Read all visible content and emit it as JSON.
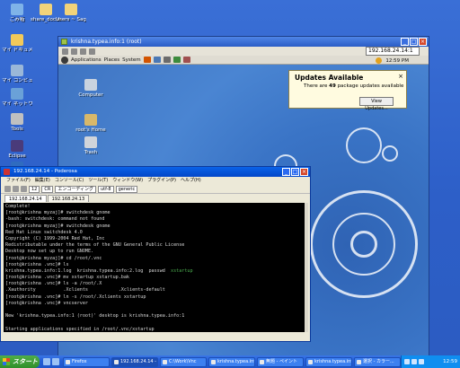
{
  "desktop_icons": [
    {
      "label": "ごみ箱",
      "icon": "recycle-bin-icon",
      "color": "#7fb3e8"
    },
    {
      "label": "share_docum",
      "icon": "folder-icon",
      "color": "#f2d37a"
    },
    {
      "label": "Users ~ Sagem",
      "icon": "folder-icon",
      "color": "#f2d37a"
    },
    {
      "label": "マイ ドキュメント",
      "icon": "my-documents-icon",
      "color": "#f2c95a"
    },
    {
      "label": "マイ コンピュータ",
      "icon": "my-computer-icon",
      "color": "#9ab7d8"
    },
    {
      "label": "マイ ネットワーク",
      "icon": "network-places-icon",
      "color": "#6aa1d8"
    },
    {
      "label": "Tools",
      "icon": "tools-icon",
      "color": "#c0c0c0"
    },
    {
      "label": "Eclipse",
      "icon": "eclipse-icon",
      "color": "#4a3b7a"
    },
    {
      "label": "VirtualBox",
      "icon": "virtualbox-icon",
      "color": "#2f6cc0"
    }
  ],
  "vnc_window": {
    "title": "krishna.typea.info:1 (root)",
    "ip": "192.168.24.14:1"
  },
  "gnome_panel": {
    "menus": [
      "Applications",
      "Places",
      "System"
    ],
    "clock": "12:59 PM"
  },
  "gnome_icons": [
    {
      "label": "Computer",
      "icon": "computer-icon",
      "color": "#c9d3df"
    },
    {
      "label": "root's Home",
      "icon": "home-folder-icon",
      "color": "#d8b86a"
    },
    {
      "label": "Trash",
      "icon": "trash-icon",
      "color": "#d0d4da"
    }
  ],
  "notification": {
    "title": "Updates Available",
    "prefix": "There are",
    "count": "49",
    "suffix": "package updates available",
    "button": "View Updates...",
    "close": "×"
  },
  "putty": {
    "title": "192.168.24.14 - Poderosa",
    "menus": [
      "ファイル(F)",
      "編集(E)",
      "コンソール(C)",
      "ツール(T)",
      "ウィンドウ(W)",
      "プラグイン(P)",
      "ヘルプ(H)"
    ],
    "toolbar_size": "12",
    "toolbar_newline": "CR",
    "toolbar_encoding_label": "エンコーディング",
    "toolbar_encoding": "utf-8",
    "toolbar_terminal": "generic",
    "tabs": [
      "192.168.24.14",
      "192.168.24.13"
    ],
    "lines": [
      {
        "text": "Complete!",
        "parts": []
      },
      {
        "text": "[root@krishna myzaj]# switchdesk gnome",
        "parts": []
      },
      {
        "text": "-bash: switchdesk: command not found",
        "parts": []
      },
      {
        "text": "[root@krishna myzaj]# switchdesk gnome",
        "parts": []
      },
      {
        "text": "Red Hat Linux switchdesk 4.0",
        "parts": []
      },
      {
        "text": "Copyright (C) 1999-2004 Red Hat, Inc",
        "parts": []
      },
      {
        "text": "Redistributable under the terms of the GNU General Public License",
        "parts": []
      },
      {
        "text": "Desktop now set up to run GNOME.",
        "parts": []
      },
      {
        "text": "[root@krishna myzaj]# cd /root/.vnc",
        "parts": []
      },
      {
        "text": "[root@krishna .vnc]# ls",
        "parts": []
      },
      {
        "text": "",
        "parts": [
          {
            "t": "krishna.typea.info:1.log  krishna.typea.info:2.log  passwd  ",
            "c": "#d8d8d8"
          },
          {
            "t": "xstartup",
            "c": "#4caf50"
          }
        ]
      },
      {
        "text": "[root@krishna .vnc]# mv xstartup xstartup.bak",
        "parts": []
      },
      {
        "text": "[root@krishna .vnc]# ls -a /root/.X",
        "parts": []
      },
      {
        "text": ".Xauthority          .Xclients           .Xclients-default",
        "parts": []
      },
      {
        "text": "[root@krishna .vnc]# ln -s /root/.Xclients xstartup",
        "parts": []
      },
      {
        "text": "[root@krishna .vnc]# vncserver",
        "parts": []
      },
      {
        "text": "",
        "parts": []
      },
      {
        "text": "New 'krishna.typea.info:1 (root)' desktop is krishna.typea.info:1",
        "parts": []
      },
      {
        "text": "",
        "parts": []
      },
      {
        "text": "Starting applications specified in /root/.vnc/xstartup",
        "parts": []
      },
      {
        "text": "Log file is /root/.vnc/krishna.typea.info:1.log",
        "parts": []
      },
      {
        "text": "",
        "parts": []
      },
      {
        "text": "[root@krishna .vnc]# ",
        "parts": []
      }
    ]
  },
  "taskbar": {
    "start": "スタート",
    "tasks": [
      "Firefox",
      "192.168.24.14 - Poder...",
      "C:\\Work\\Vnc",
      "krishna.typea.info:1 - ...",
      "無題 - ペイント",
      "krishna.typea.info:1 - ...",
      "選択 - カラー..."
    ],
    "active_index": 1,
    "time": "12:59"
  }
}
